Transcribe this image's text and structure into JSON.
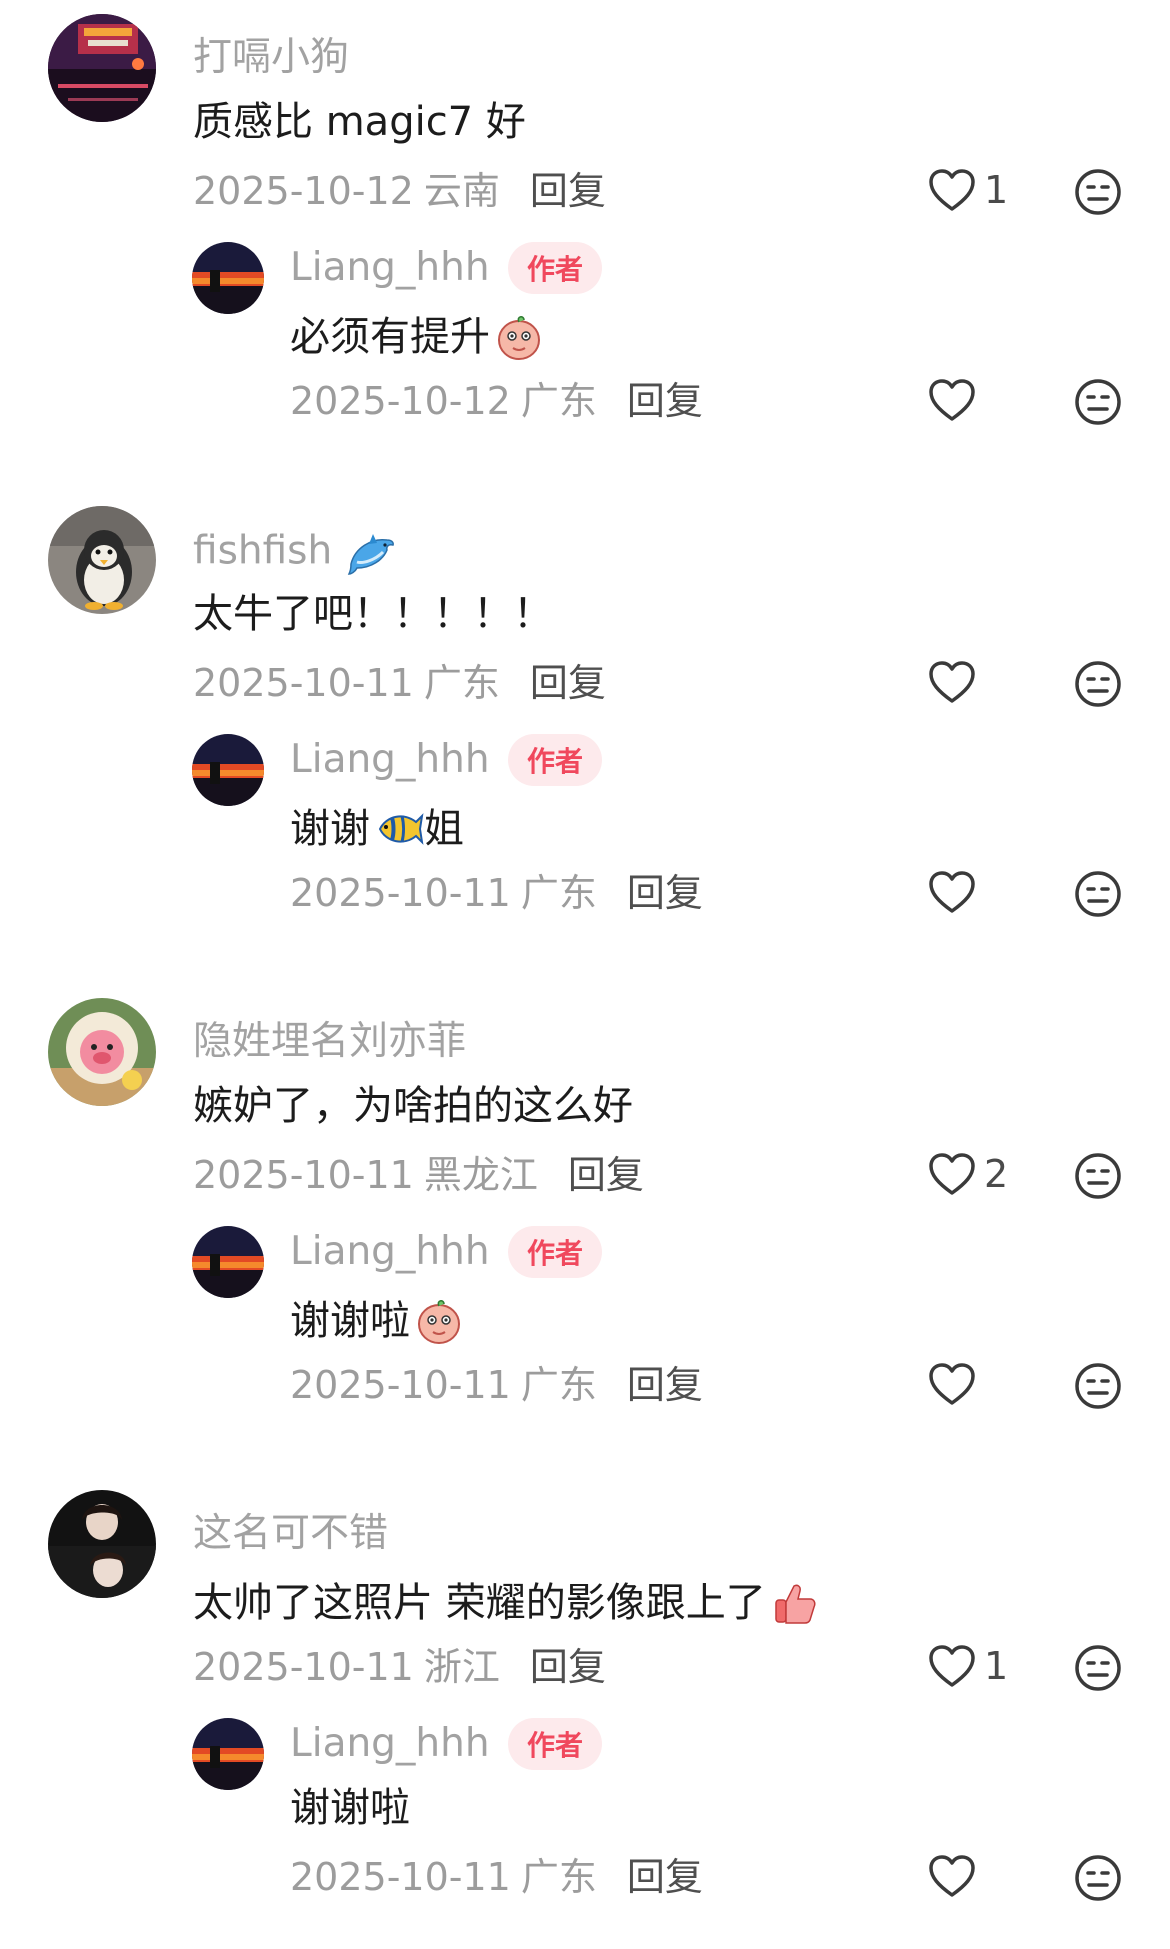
{
  "colors": {
    "username": "#a2a2a2",
    "content": "#1c1c1c",
    "meta": "#9c9c9c",
    "reply_action": "#4f4f4f",
    "author_badge_bg": "#fdeaec",
    "author_badge_text": "#f0485d",
    "icon": "#3a3a3a"
  },
  "comments": [
    {
      "username": "打嗝小狗",
      "content": "质感比 magic7 好",
      "date": "2025-10-12",
      "location": "云南",
      "reply_label": "回复",
      "likes": "1",
      "avatar_icon": "city-night-avatar",
      "reply": {
        "username": "Liang_hhh",
        "badge": "作者",
        "content": "必须有提升",
        "content_emoji": "shy-peach-emoji",
        "date": "2025-10-12",
        "location": "广东",
        "reply_label": "回复",
        "likes": ""
      }
    },
    {
      "username": "fishfish",
      "username_emoji": "dolphin-emoji",
      "content": "太牛了吧！！！！！",
      "date": "2025-10-11",
      "location": "广东",
      "reply_label": "回复",
      "likes": "",
      "avatar_icon": "penguin-plush-avatar",
      "reply": {
        "username": "Liang_hhh",
        "badge": "作者",
        "content_before": "谢谢",
        "content_emoji": "tropical-fish-emoji",
        "content_after": "姐",
        "date": "2025-10-11",
        "location": "广东",
        "reply_label": "回复",
        "likes": ""
      }
    },
    {
      "username": "隐姓埋名刘亦菲",
      "content": "嫉妒了，为啥拍的这么好",
      "date": "2025-10-11",
      "location": "黑龙江",
      "reply_label": "回复",
      "likes": "2",
      "avatar_icon": "pink-plush-avatar",
      "reply": {
        "username": "Liang_hhh",
        "badge": "作者",
        "content": "谢谢啦",
        "content_emoji": "shy-peach-emoji",
        "date": "2025-10-11",
        "location": "广东",
        "reply_label": "回复",
        "likes": ""
      }
    },
    {
      "username": "这名可不错",
      "content": "太帅了这照片 荣耀的影像跟上了",
      "content_emoji": "thumbs-up-emoji",
      "date": "2025-10-11",
      "location": "浙江",
      "reply_label": "回复",
      "likes": "1",
      "avatar_icon": "portrait-avatar",
      "reply": {
        "username": "Liang_hhh",
        "badge": "作者",
        "content": "谢谢啦",
        "date": "2025-10-11",
        "location": "广东",
        "reply_label": "回复",
        "likes": ""
      }
    }
  ]
}
